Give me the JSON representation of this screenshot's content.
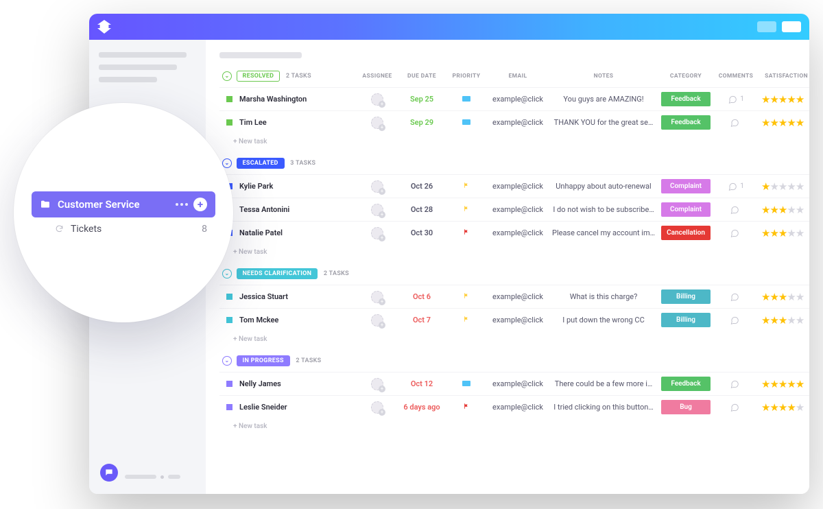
{
  "sidebar_overlay": {
    "space_name": "Customer Service",
    "list_name": "Tickets",
    "list_count": "8"
  },
  "columns": {
    "assignee": "ASSIGNEE",
    "due_date": "DUE DATE",
    "priority": "PRIORITY",
    "email": "EMAIL",
    "notes": "NOTES",
    "category": "CATEGORY",
    "comments": "COMMENTS",
    "satisfaction": "SATISFACTION LEVEL"
  },
  "new_task_label": "+ New task",
  "groups": [
    {
      "status": "RESOLVED",
      "status_color": "#6bc950",
      "outline": true,
      "count_label": "2 TASKS",
      "tasks": [
        {
          "name": "Marsha Washington",
          "due": "Sep 25",
          "due_color": "#6bc950",
          "flag_color": "#4fc3f7",
          "prio_block": true,
          "email": "example@click",
          "note": "You guys are AMAZING!",
          "category": "Feedback",
          "cat_color": "#55c267",
          "comments": "1",
          "rating": 5
        },
        {
          "name": "Tim Lee",
          "due": "Sep 29",
          "due_color": "#6bc950",
          "flag_color": "#4fc3f7",
          "prio_block": true,
          "email": "example@click",
          "note": "THANK YOU for the great se…",
          "category": "Feedback",
          "cat_color": "#55c267",
          "comments": "",
          "rating": 5
        }
      ]
    },
    {
      "status": "ESCALATED",
      "status_color": "#3b5bff",
      "outline": false,
      "count_label": "3 TASKS",
      "tasks": [
        {
          "name": "Kylie Park",
          "due": "Oct 26",
          "due_color": "#55556a",
          "flag_color": "#ffcf3f",
          "email": "example@click",
          "note": "Unhappy about auto-renewal",
          "category": "Complaint",
          "cat_color": "#d67ae8",
          "comments": "1",
          "rating": 1
        },
        {
          "name": "Tessa Antonini",
          "due": "Oct 28",
          "due_color": "#55556a",
          "flag_color": "#ffcf3f",
          "email": "example@click",
          "note": "I do not wish to be subscribe…",
          "category": "Complaint",
          "cat_color": "#d67ae8",
          "comments": "",
          "rating": 3
        },
        {
          "name": "Natalie Patel",
          "due": "Oct 30",
          "due_color": "#55556a",
          "flag_color": "#e53935",
          "email": "example@click",
          "note": "Please cancel my account im…",
          "category": "Cancellation",
          "cat_color": "#e53935",
          "comments": "",
          "rating": 3
        }
      ]
    },
    {
      "status": "NEEDS CLARIFICATION",
      "status_color": "#43c6d8",
      "outline": false,
      "count_label": "2 TASKS",
      "tasks": [
        {
          "name": "Jessica Stuart",
          "due": "Oct 6",
          "due_color": "#ec5b5b",
          "flag_color": "#ffcf3f",
          "email": "example@click",
          "note": "What is this charge?",
          "category": "Billing",
          "cat_color": "#4db8c7",
          "comments": "",
          "rating": 3
        },
        {
          "name": "Tom Mckee",
          "due": "Oct 7",
          "due_color": "#ec5b5b",
          "flag_color": "#ffcf3f",
          "email": "example@click",
          "note": "I put down the wrong CC",
          "category": "Billing",
          "cat_color": "#4db8c7",
          "comments": "",
          "rating": 3
        }
      ]
    },
    {
      "status": "IN PROGRESS",
      "status_color": "#8e7bff",
      "outline": false,
      "count_label": "2 TASKS",
      "tasks": [
        {
          "name": "Nelly James",
          "due": "Oct 12",
          "due_color": "#ec5b5b",
          "flag_color": "#4fc3f7",
          "prio_block": true,
          "email": "example@click",
          "note": "There could be a few more i…",
          "category": "Feedback",
          "cat_color": "#55c267",
          "comments": "",
          "rating": 5
        },
        {
          "name": "Leslie Sneider",
          "due": "6 days ago",
          "due_color": "#ec5b5b",
          "flag_color": "#e53935",
          "email": "example@click",
          "note": "I tried clicking on this button…",
          "category": "Bug",
          "cat_color": "#f07ba0",
          "comments": "",
          "rating": 4
        }
      ]
    }
  ]
}
